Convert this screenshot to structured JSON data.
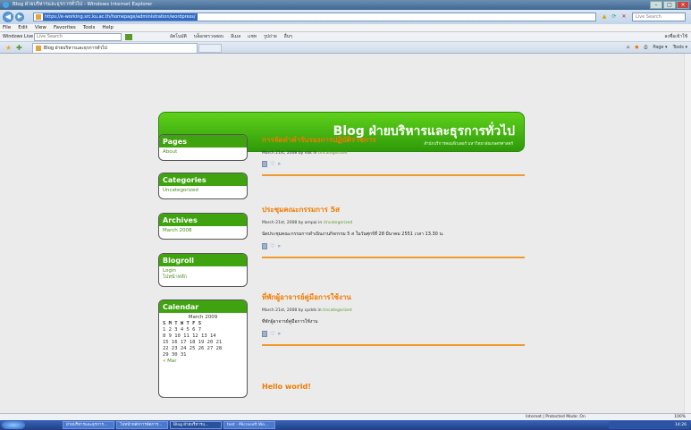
{
  "window": {
    "title": "Blog ฝ่ายบริหารและธุรการทั่วไป - Windows Internet Explorer"
  },
  "address": {
    "url": "https://e-working.src.ku.ac.th/homepage/administration/wordpress/",
    "search_placeholder": "Live Search"
  },
  "menu": [
    "File",
    "Edit",
    "View",
    "Favorites",
    "Tools",
    "Help"
  ],
  "links_bar": {
    "label": "Windows Live",
    "search_placeholder": "Live Search",
    "links": [
      "อัตโนมัติ",
      "บล็อกตรวจสอบ",
      "อีเมล",
      "แชท",
      "รูปถ่าย",
      "อื่นๆ"
    ],
    "right": "ลงชื่อเข้าใช้"
  },
  "tab": {
    "title": "Blog ฝ่ายบริหารและธุรการทั่วไป"
  },
  "toolbar_right": [
    "Page ▾",
    "Tools ▾"
  ],
  "header": {
    "title": "Blog ฝ่ายบริหารและธุรการทั่วไป",
    "subtitle": "สำนักบริการคอมพิวเตอร์ มหาวิทยาลัยเกษตรศาสตร์"
  },
  "sidebar": {
    "pages": {
      "title": "Pages",
      "items": [
        "About"
      ]
    },
    "categories": {
      "title": "Categories",
      "items": [
        "Uncategorized"
      ]
    },
    "archives": {
      "title": "Archives",
      "items": [
        "March 2008"
      ]
    },
    "blogroll": {
      "title": "Blogroll",
      "items": [
        "Login",
        "ไปหน้าหลัก"
      ]
    },
    "calendar": {
      "title": "Calendar",
      "month": "March 2009",
      "header": "S M T W T F S",
      "rows": [
        "1  2  3  4  5  6  7",
        "8  9 10 11 12 13 14",
        "15 16 17 18 19 20 21",
        "22 23 24 25 26 27 28",
        "29 30 31"
      ],
      "prev": "« Mar"
    }
  },
  "posts": [
    {
      "title": "การจัดทำคำรับรองการปฏิบัติราชการ",
      "meta_prefix": "March 21st, 2008 by nok in ",
      "category": "Uncategorized",
      "body": ""
    },
    {
      "title": "ประชุมคณะกรรมการ 5ส",
      "meta_prefix": "March 21st, 2008 by ampai in ",
      "category": "Uncategorized",
      "body": "นัดประชุมคณะกรรมการดำเนินงานกิจกรรม 5 ส ในวันศุกร์ที่ 28 มีนาคม 2551 เวลา 13.30 น."
    },
    {
      "title": "ที่พักผู้อาจารย์คู่มือการใช้งาน",
      "meta_prefix": "March 21st, 2008 by cpdds in ",
      "category": "Uncategorized",
      "body": "ที่พักผู้อาจารย์คู่มือการใช้งาน"
    },
    {
      "title": "Hello world!",
      "meta_prefix": "",
      "category": "",
      "body": ""
    }
  ],
  "status": {
    "zone": "Internet | Protected Mode: On",
    "zoom": "100%"
  },
  "taskbar": {
    "buttons": [
      "ฝ่ายบริหารและธุรการ...",
      "ไปหน้าหลักการจัดการ...",
      "Blog ฝ่ายบริหารแ...",
      "test - Microsoft Wo..."
    ],
    "clock": "14:26"
  }
}
